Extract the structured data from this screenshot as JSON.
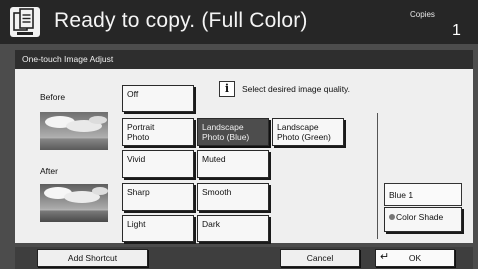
{
  "header": {
    "icon": "copy-document-icon",
    "title": "Ready to copy. (Full Color)",
    "copies_label": "Copies",
    "copies_count": "1"
  },
  "tab": {
    "label": "One-touch Image Adjust"
  },
  "preview": {
    "before_label": "Before",
    "after_label": "After"
  },
  "info": {
    "icon": "info-icon",
    "message": "Select desired image quality."
  },
  "options": {
    "off": "Off",
    "portrait": [
      "Portrait",
      "Photo"
    ],
    "landscape_blue": [
      "Landscape",
      "Photo (Blue)"
    ],
    "landscape_green": [
      "Landscape",
      "Photo (Green)"
    ],
    "vivid": "Vivid",
    "muted": "Muted",
    "sharp": "Sharp",
    "smooth": "Smooth",
    "light": "Light",
    "dark": "Dark",
    "selected": "Landscape Photo (Blue)"
  },
  "color_shade": {
    "value": "Blue 1",
    "button_label": "Color Shade"
  },
  "footer": {
    "add_shortcut": "Add Shortcut",
    "cancel": "Cancel",
    "ok": "OK",
    "ok_icon": "enter-arrow-icon"
  },
  "colors": {
    "header_bg": "#262626",
    "selected_bg": "#4d4d4d",
    "panel_bg": "#efefef",
    "frame_bg": "#4c4c4c"
  }
}
